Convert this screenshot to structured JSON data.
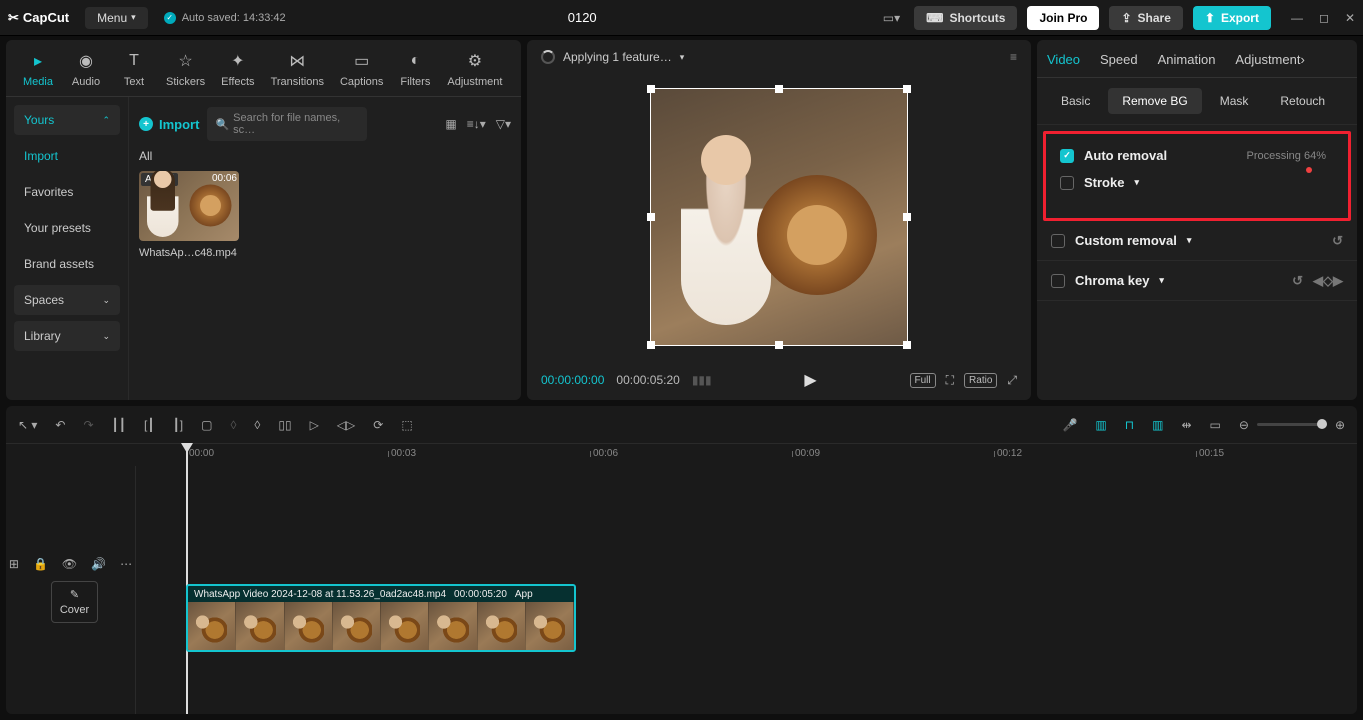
{
  "app": {
    "name": "CapCut",
    "menu": "Menu",
    "auto_saved": "Auto saved: 14:33:42",
    "project_title": "0120"
  },
  "titlebar": {
    "shortcuts": "Shortcuts",
    "join_pro": "Join Pro",
    "share": "Share",
    "export": "Export"
  },
  "tool_tabs": [
    {
      "icon": "▸",
      "label": "Media"
    },
    {
      "icon": "◉",
      "label": "Audio"
    },
    {
      "icon": "T",
      "label": "Text"
    },
    {
      "icon": "☆",
      "label": "Stickers"
    },
    {
      "icon": "✦",
      "label": "Effects"
    },
    {
      "icon": "⋈",
      "label": "Transitions"
    },
    {
      "icon": "▭",
      "label": "Captions"
    },
    {
      "icon": "◐",
      "label": "Filters"
    },
    {
      "icon": "⚙",
      "label": "Adjustment"
    }
  ],
  "sidebar": {
    "items": [
      "Yours",
      "Import",
      "Favorites",
      "Your presets",
      "Brand assets",
      "Spaces",
      "Library"
    ]
  },
  "media": {
    "import_label": "Import",
    "search_placeholder": "Search for file names, sc…",
    "all_label": "All",
    "thumb_added": "Added",
    "thumb_duration": "00:06",
    "thumb_name": "WhatsAp…c48.mp4"
  },
  "preview": {
    "applying": "Applying 1 feature…",
    "time_current": "00:00:00:00",
    "time_duration": "00:00:05:20",
    "full": "Full",
    "ratio": "Ratio"
  },
  "props": {
    "tabs": [
      "Video",
      "Speed",
      "Animation",
      "Adjustment"
    ],
    "sub_tabs": [
      "Basic",
      "Remove BG",
      "Mask",
      "Retouch"
    ],
    "rows": {
      "auto_removal": "Auto removal",
      "processing": "Processing 64%",
      "stroke": "Stroke",
      "custom_removal": "Custom removal",
      "chroma_key": "Chroma key"
    }
  },
  "timeline": {
    "ticks": [
      "00:00",
      "00:03",
      "00:06",
      "00:09",
      "00:12",
      "00:15"
    ],
    "clip_name": "WhatsApp Video 2024-12-08 at 11.53.26_0ad2ac48.mp4",
    "clip_dur": "00:00:05:20",
    "clip_extra": "App",
    "cover": "Cover"
  }
}
